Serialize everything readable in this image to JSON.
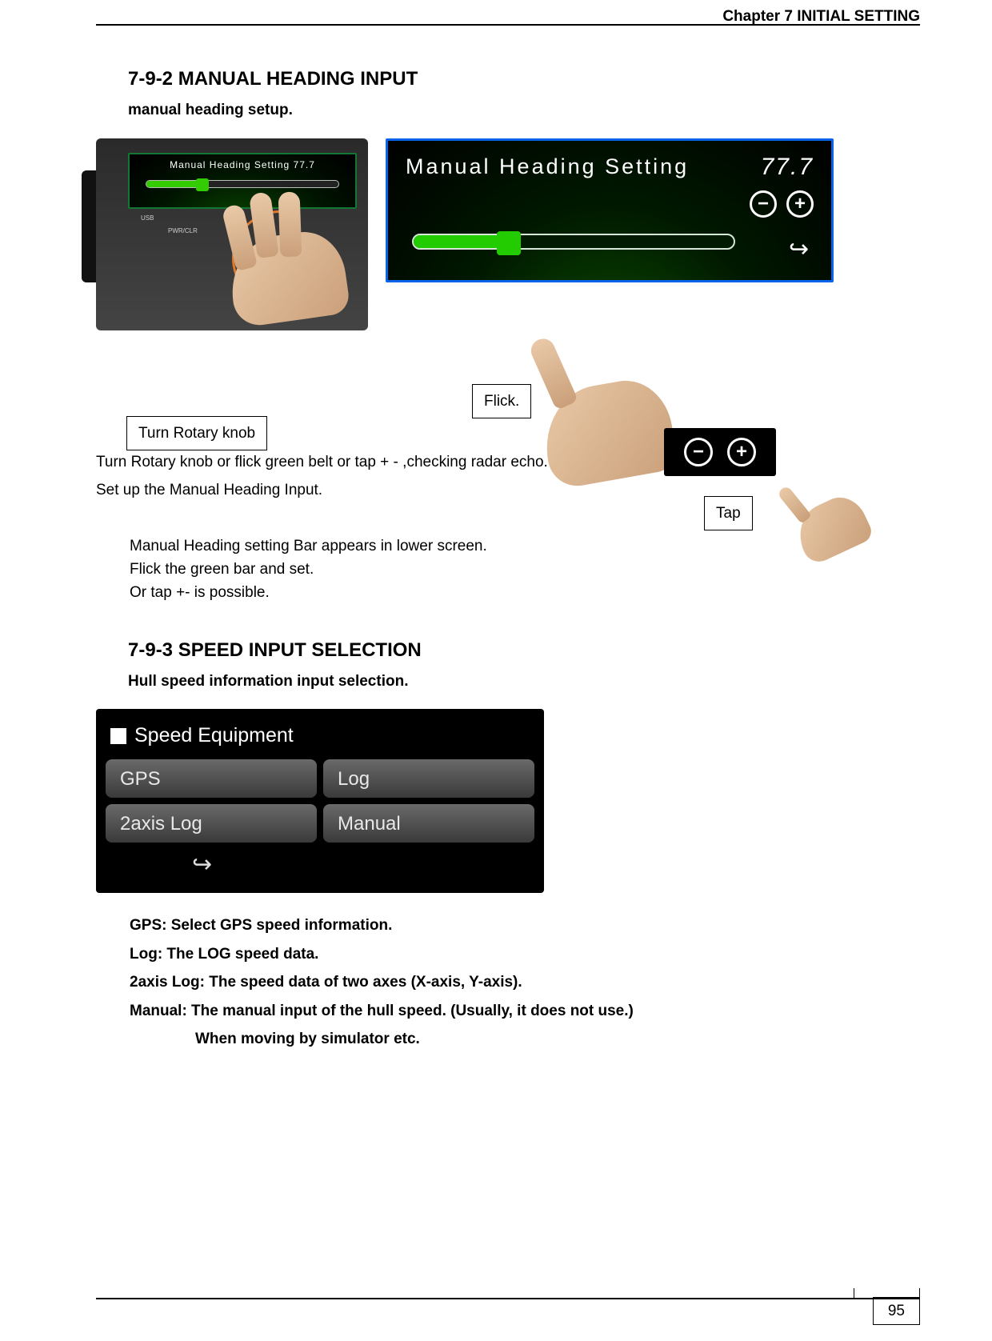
{
  "header": {
    "chapter": "Chapter 7   INITIAL SETTING"
  },
  "section_792": {
    "number_title": "7-9-2 MANUAL HEADING INPUT",
    "subtitle": "manual heading setup."
  },
  "device_small": {
    "screen_title": "Manual Heading Setting  77.7",
    "usb": "USB",
    "pwr": "PWR/CLR"
  },
  "big_screen": {
    "title": "Manual  Heading  Setting",
    "value": "77.7",
    "minus": "−",
    "plus": "+",
    "back": "↩"
  },
  "callouts": {
    "rotary": "Turn Rotary knob",
    "flick": "Flick.",
    "tap": "Tap"
  },
  "pm_chip": {
    "minus": "−",
    "plus": "+"
  },
  "instr": {
    "l1": "Turn Rotary knob or flick green belt or tap + - ,checking radar echo.",
    "l2": "Set up the Manual Heading Input.",
    "l3": "Manual Heading setting Bar appears in lower screen.",
    "l4": "Flick the green bar and set.",
    "l5": "Or tap +- is possible."
  },
  "section_793": {
    "number_title": "7-9-3 SPEED INPUT SELECTION",
    "subtitle": "Hull speed information input selection."
  },
  "speed_panel": {
    "title": "Speed Equipment",
    "buttons": [
      "GPS",
      "Log",
      "2axis Log",
      "Manual"
    ],
    "back": "↩"
  },
  "definitions": {
    "gps": "GPS:   Select GPS speed information.",
    "log": "Log:   The LOG speed data.",
    "twoaxis": "2axis Log: The speed data of two axes (X-axis, Y-axis).",
    "manual1": "Manual: The manual input of the hull speed. (Usually, it does not use.)",
    "manual2": "When moving by simulator etc."
  },
  "page_number": "95"
}
